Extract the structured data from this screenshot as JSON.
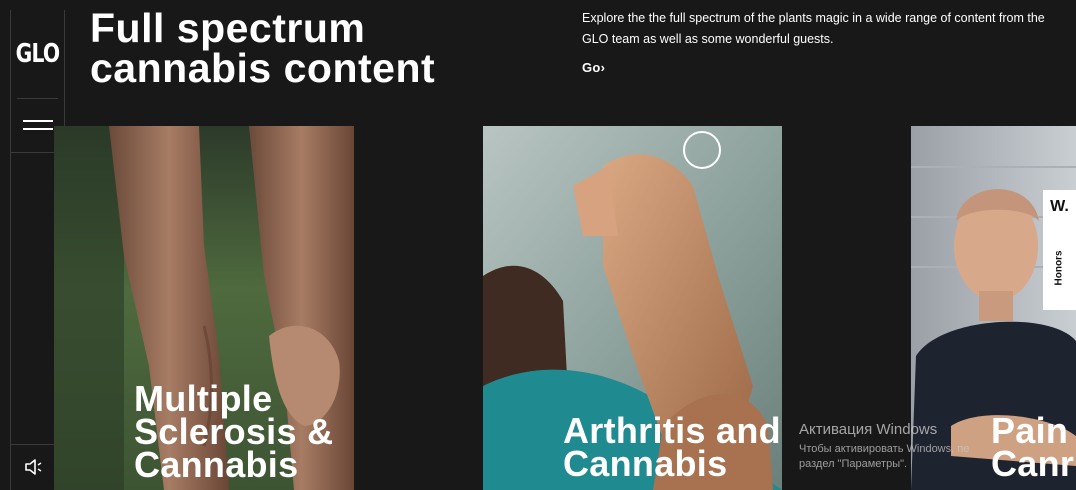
{
  "sidebar": {
    "logo": "GLO",
    "menu_icon": "hamburger-icon",
    "sound_icon": "speaker-icon"
  },
  "hero": {
    "title_line1": "Full spectrum",
    "title_line2": "cannabis content",
    "description": "Explore the the full spectrum of the plants magic in a wide range of content from the GLO team as well as some wonderful guests.",
    "go_label": "Go›"
  },
  "cards": [
    {
      "title_line1": "Multiple",
      "title_line2": "Sclerosis &",
      "title_line3": "Cannabis"
    },
    {
      "title_line1": "Arthritis and",
      "title_line2": "Cannabis"
    },
    {
      "title_line1": "Pain",
      "title_line2": "Canr"
    }
  ],
  "award_badge": {
    "logo": "W.",
    "label": "Honors"
  },
  "watermark": {
    "line1": "Активация Windows",
    "line2": "Чтобы активировать Windows, пе",
    "line3": "раздел \"Параметры\"."
  },
  "colors": {
    "background": "#181818",
    "text": "#ffffff",
    "divider": "#3a3a3a"
  }
}
